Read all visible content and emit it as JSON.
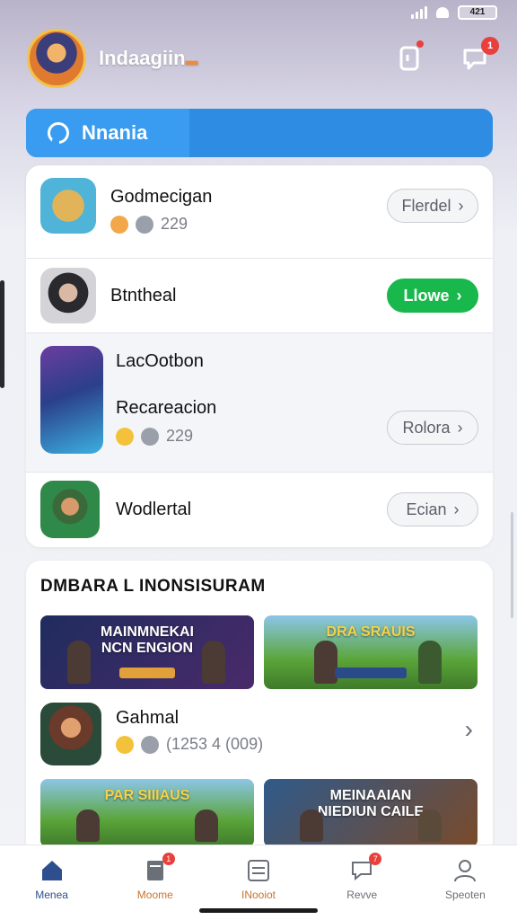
{
  "status_bar": {
    "battery": "421"
  },
  "header": {
    "username": "Indaagiin",
    "username_suffix": "▬",
    "notif_badge": "",
    "message_badge": "1"
  },
  "banner": {
    "label": "Nnania"
  },
  "list": [
    {
      "title": "Godmecigan",
      "meta": "229",
      "action": "Flerdel",
      "style": "outline"
    },
    {
      "title": "Btntheal",
      "meta": "",
      "action": "Llowe",
      "style": "green"
    },
    {
      "title": "LacOotbon",
      "subtitle": "Recareacion",
      "meta": "229",
      "action": "Rolora",
      "style": "outline"
    },
    {
      "title": "Wodlertal",
      "meta": "",
      "action": "Ecian",
      "style": "outline"
    }
  ],
  "section": {
    "title": "DMBARA L INONSISURAM",
    "promos": [
      {
        "text1": "MAINMNEKAI",
        "text2": "NCN ENGION",
        "bg": "#1f2c5e"
      },
      {
        "text1": "DRA SRAUIS",
        "text2": "",
        "bg": "#4f9a3a"
      },
      {
        "text1": "PAR SIIIAUS",
        "text2": "",
        "bg": "#5aa53a"
      },
      {
        "text1": "MEINAAIAN",
        "text2": "NIEDIUN CAILE",
        "bg": "#2f5a8a"
      }
    ],
    "row": {
      "title": "Gahmal",
      "meta": "(1253 4 (009)"
    }
  },
  "tabs": [
    {
      "label": "Menea",
      "active": true,
      "badge": ""
    },
    {
      "label": "Moome",
      "active": false,
      "badge": "1"
    },
    {
      "label": "INooiot",
      "active": false,
      "badge": ""
    },
    {
      "label": "Revve",
      "active": false,
      "badge": "7"
    },
    {
      "label": "Speoten",
      "active": false,
      "badge": ""
    }
  ],
  "colors": {
    "accent_blue": "#2e8de3",
    "green": "#19b84c",
    "badge_red": "#e8403c",
    "active_tab": "#2d4f8f",
    "orange_tab": "#c9742e"
  },
  "icons": {
    "header_left": "bookmark-icon",
    "header_right": "message-icon",
    "banner": "chat-bubble-icon",
    "tab_home": "home-icon",
    "tab_chat": "book-icon",
    "tab_grid": "grid-icon",
    "tab_reviews": "speech-icon",
    "tab_profile": "person-icon"
  }
}
